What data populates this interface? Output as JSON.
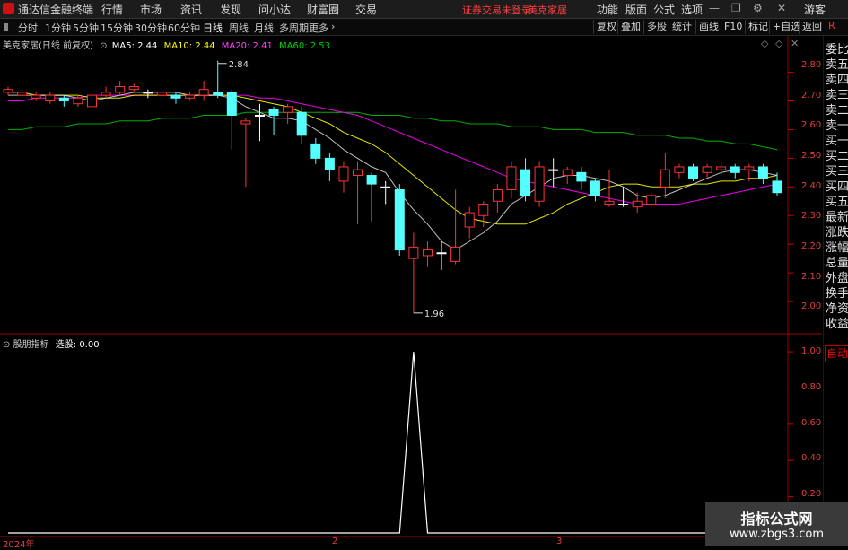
{
  "app": {
    "title": "通达信金融终端",
    "menu": [
      "行情",
      "市场",
      "资讯",
      "发现",
      "问小达",
      "财富圈",
      "交易"
    ],
    "notice": "证券交易未登录",
    "stock_name": "美克家居",
    "right_menu": [
      "功能",
      "版面",
      "公式",
      "选项"
    ],
    "user": "游客",
    "corner": "R"
  },
  "toolbar": {
    "periods": [
      "分时",
      "1分钟",
      "5分钟",
      "15分钟",
      "30分钟",
      "60分钟",
      "日线",
      "周线",
      "月线",
      "多周期",
      "更多"
    ],
    "active_period": "日线",
    "right_buttons": [
      "复权",
      "叠加",
      "多股",
      "统计",
      "画线",
      "F10",
      "标记",
      "+自选",
      "返回"
    ]
  },
  "main_legend": {
    "title": "美克家居(日线 前复权)",
    "ma5": "MA5: 2.44",
    "ma10": "MA10: 2.44",
    "ma20": "MA20: 2.41",
    "ma60": "MA60: 2.53"
  },
  "sub_legend": {
    "title": "股朋指标",
    "value": "选股: 0.00"
  },
  "side_panel": [
    "委比",
    "卖五",
    "卖四",
    "卖三",
    "卖二",
    "卖一",
    "买一",
    "买二",
    "买三",
    "买四",
    "买五",
    "最新",
    "涨跌",
    "涨幅",
    "总量",
    "外盘",
    "换手",
    "净资",
    "收益"
  ],
  "auto_label": "自动",
  "price_axis": [
    "2.80",
    "2.70",
    "2.60",
    "2.50",
    "2.40",
    "2.30",
    "2.20",
    "2.10",
    "2.00"
  ],
  "sub_axis": [
    "1.00",
    "0.80",
    "0.60",
    "0.40",
    "0.20"
  ],
  "x_axis": [
    "2024年",
    "2",
    "3"
  ],
  "annotations": {
    "high": "2.84",
    "low": "1.96"
  },
  "watermark": {
    "title": "指标公式网",
    "url": "www.zbgs3.com"
  },
  "colors": {
    "up": "#ff3232",
    "down": "#54ffff",
    "ma5": "#ffffff",
    "ma10": "#ffff00",
    "ma20": "#ff00ff",
    "ma60": "#00c000"
  },
  "chart_data": {
    "type": "candlestick",
    "y_range": [
      1.9,
      2.88
    ],
    "candles": [
      [
        2.73,
        2.74,
        2.72,
        2.75
      ],
      [
        2.72,
        2.73,
        2.71,
        2.74
      ],
      [
        2.71,
        2.72,
        2.7,
        2.73
      ],
      [
        2.7,
        2.72,
        2.69,
        2.73
      ],
      [
        2.71,
        2.7,
        2.68,
        2.72
      ],
      [
        2.69,
        2.71,
        2.68,
        2.72
      ],
      [
        2.68,
        2.72,
        2.66,
        2.73
      ],
      [
        2.72,
        2.73,
        2.71,
        2.75
      ],
      [
        2.73,
        2.75,
        2.72,
        2.77
      ],
      [
        2.74,
        2.75,
        2.73,
        2.76
      ],
      [
        2.73,
        2.73,
        2.71,
        2.74
      ],
      [
        2.72,
        2.73,
        2.7,
        2.74
      ],
      [
        2.72,
        2.71,
        2.69,
        2.73
      ],
      [
        2.71,
        2.72,
        2.7,
        2.73
      ],
      [
        2.72,
        2.74,
        2.7,
        2.77
      ],
      [
        2.73,
        2.72,
        2.71,
        2.84
      ],
      [
        2.73,
        2.65,
        2.53,
        2.74
      ],
      [
        2.62,
        2.63,
        2.4,
        2.64
      ],
      [
        2.65,
        2.65,
        2.56,
        2.69
      ],
      [
        2.67,
        2.65,
        2.58,
        2.68
      ],
      [
        2.66,
        2.68,
        2.62,
        2.69
      ],
      [
        2.66,
        2.58,
        2.55,
        2.68
      ],
      [
        2.55,
        2.5,
        2.48,
        2.57
      ],
      [
        2.5,
        2.46,
        2.42,
        2.52
      ],
      [
        2.42,
        2.47,
        2.38,
        2.49
      ],
      [
        2.44,
        2.46,
        2.27,
        2.49
      ],
      [
        2.44,
        2.41,
        2.28,
        2.45
      ],
      [
        2.4,
        2.4,
        2.34,
        2.42
      ],
      [
        2.39,
        2.18,
        2.16,
        2.41
      ],
      [
        2.15,
        2.19,
        1.96,
        2.24
      ],
      [
        2.16,
        2.18,
        2.12,
        2.21
      ],
      [
        2.17,
        2.17,
        2.11,
        2.21
      ],
      [
        2.14,
        2.19,
        2.13,
        2.39
      ],
      [
        2.26,
        2.31,
        2.22,
        2.33
      ],
      [
        2.3,
        2.34,
        2.26,
        2.35
      ],
      [
        2.35,
        2.39,
        2.31,
        2.41
      ],
      [
        2.39,
        2.47,
        2.36,
        2.49
      ],
      [
        2.46,
        2.37,
        2.35,
        2.5
      ],
      [
        2.35,
        2.47,
        2.33,
        2.49
      ],
      [
        2.46,
        2.46,
        2.4,
        2.5
      ],
      [
        2.44,
        2.46,
        2.41,
        2.47
      ],
      [
        2.45,
        2.42,
        2.39,
        2.47
      ],
      [
        2.42,
        2.37,
        2.35,
        2.43
      ],
      [
        2.34,
        2.35,
        2.33,
        2.46
      ],
      [
        2.34,
        2.34,
        2.33,
        2.4
      ],
      [
        2.33,
        2.35,
        2.31,
        2.38
      ],
      [
        2.34,
        2.37,
        2.33,
        2.38
      ],
      [
        2.4,
        2.46,
        2.36,
        2.52
      ],
      [
        2.45,
        2.47,
        2.43,
        2.48
      ],
      [
        2.47,
        2.43,
        2.42,
        2.48
      ],
      [
        2.45,
        2.47,
        2.43,
        2.48
      ],
      [
        2.46,
        2.47,
        2.44,
        2.49
      ],
      [
        2.47,
        2.45,
        2.43,
        2.48
      ],
      [
        2.46,
        2.47,
        2.42,
        2.48
      ],
      [
        2.47,
        2.43,
        2.41,
        2.48
      ],
      [
        2.42,
        2.38,
        2.37,
        2.45
      ]
    ],
    "ma5": [
      2.72,
      2.72,
      2.72,
      2.72,
      2.72,
      2.71,
      2.7,
      2.71,
      2.72,
      2.73,
      2.73,
      2.73,
      2.73,
      2.72,
      2.72,
      2.72,
      2.71,
      2.68,
      2.66,
      2.64,
      2.64,
      2.63,
      2.6,
      2.57,
      2.53,
      2.5,
      2.47,
      2.45,
      2.38,
      2.32,
      2.27,
      2.21,
      2.18,
      2.21,
      2.24,
      2.28,
      2.34,
      2.37,
      2.4,
      2.43,
      2.44,
      2.44,
      2.43,
      2.42,
      2.4,
      2.37,
      2.36,
      2.37,
      2.39,
      2.41,
      2.43,
      2.45,
      2.46,
      2.46,
      2.45,
      2.44
    ],
    "ma10": [
      2.73,
      2.73,
      2.72,
      2.72,
      2.72,
      2.72,
      2.71,
      2.71,
      2.71,
      2.72,
      2.72,
      2.72,
      2.72,
      2.72,
      2.72,
      2.72,
      2.72,
      2.71,
      2.7,
      2.69,
      2.68,
      2.66,
      2.64,
      2.62,
      2.59,
      2.57,
      2.55,
      2.52,
      2.48,
      2.44,
      2.4,
      2.36,
      2.32,
      2.29,
      2.28,
      2.27,
      2.27,
      2.27,
      2.29,
      2.31,
      2.34,
      2.36,
      2.38,
      2.4,
      2.41,
      2.41,
      2.4,
      2.4,
      2.4,
      2.41,
      2.41,
      2.42,
      2.42,
      2.43,
      2.43,
      2.44
    ],
    "ma20": [
      2.7,
      2.7,
      2.71,
      2.71,
      2.71,
      2.71,
      2.72,
      2.72,
      2.72,
      2.72,
      2.72,
      2.72,
      2.72,
      2.72,
      2.72,
      2.72,
      2.72,
      2.72,
      2.71,
      2.71,
      2.7,
      2.69,
      2.68,
      2.67,
      2.66,
      2.65,
      2.63,
      2.61,
      2.59,
      2.57,
      2.55,
      2.53,
      2.51,
      2.49,
      2.47,
      2.45,
      2.43,
      2.42,
      2.41,
      2.4,
      2.39,
      2.38,
      2.37,
      2.36,
      2.35,
      2.34,
      2.34,
      2.34,
      2.34,
      2.35,
      2.36,
      2.37,
      2.38,
      2.39,
      2.4,
      2.41
    ],
    "ma60": [
      2.6,
      2.6,
      2.61,
      2.61,
      2.61,
      2.62,
      2.62,
      2.62,
      2.63,
      2.63,
      2.63,
      2.64,
      2.64,
      2.64,
      2.65,
      2.65,
      2.65,
      2.66,
      2.66,
      2.66,
      2.66,
      2.66,
      2.66,
      2.66,
      2.66,
      2.66,
      2.65,
      2.65,
      2.65,
      2.64,
      2.64,
      2.63,
      2.63,
      2.62,
      2.62,
      2.62,
      2.61,
      2.61,
      2.61,
      2.6,
      2.6,
      2.6,
      2.59,
      2.59,
      2.59,
      2.58,
      2.58,
      2.58,
      2.57,
      2.57,
      2.56,
      2.56,
      2.55,
      2.55,
      2.54,
      2.53
    ],
    "indicator": {
      "name": "选股",
      "y_range": [
        0,
        1.05
      ],
      "values": [
        0,
        0,
        0,
        0,
        0,
        0,
        0,
        0,
        0,
        0,
        0,
        0,
        0,
        0,
        0,
        0,
        0,
        0,
        0,
        0,
        0,
        0,
        0,
        0,
        0,
        0,
        0,
        0,
        0,
        1,
        0,
        0,
        0,
        0,
        0,
        0,
        0,
        0,
        0,
        0,
        0,
        0,
        0,
        0,
        0,
        0,
        0,
        0,
        0,
        0,
        0,
        0,
        0,
        0,
        0,
        0
      ]
    }
  }
}
